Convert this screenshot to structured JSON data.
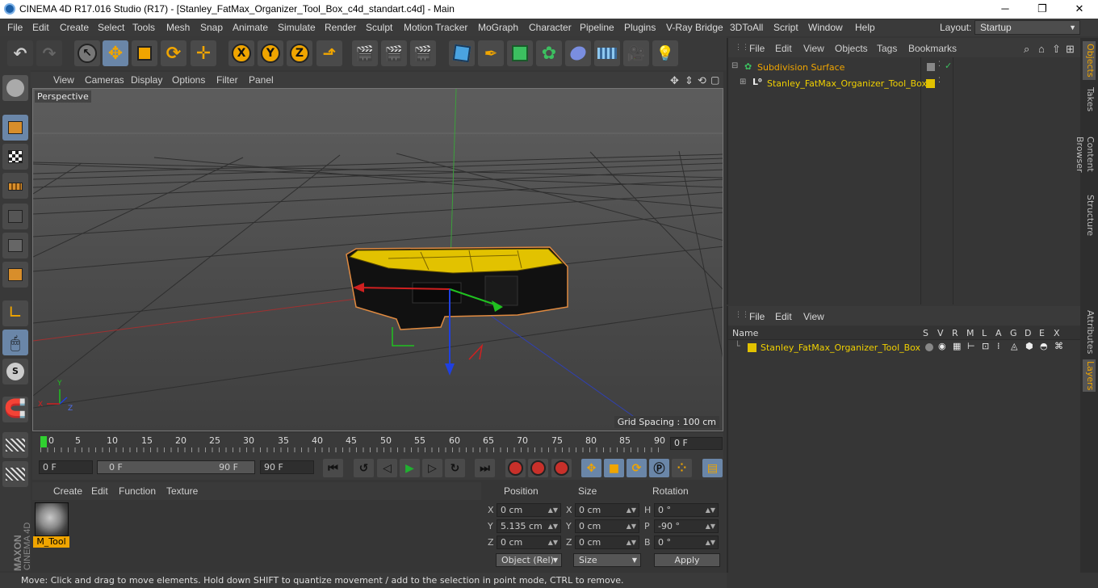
{
  "window": {
    "title": "CINEMA 4D R17.016 Studio (R17) - [Stanley_FatMax_Organizer_Tool_Box_c4d_standart.c4d] - Main",
    "minimize": "─",
    "maximize": "❐",
    "close": "✕"
  },
  "menubar": {
    "items": [
      "File",
      "Edit",
      "Create",
      "Select",
      "Tools",
      "Mesh",
      "Snap",
      "Animate",
      "Simulate",
      "Render",
      "Sculpt",
      "Motion Tracker",
      "MoGraph",
      "Character",
      "Pipeline",
      "Plugins",
      "V-Ray Bridge",
      "3DToAll",
      "Script",
      "Window",
      "Help"
    ],
    "layout_label": "Layout:",
    "layout_value": "Startup"
  },
  "toolbar": {
    "axis_x": "X",
    "axis_y": "Y",
    "axis_z": "Z"
  },
  "viewport": {
    "menu": [
      "View",
      "Cameras",
      "Display",
      "Options",
      "Filter",
      "Panel"
    ],
    "camera_label": "Perspective",
    "grid_spacing": "Grid Spacing : 100 cm",
    "axis_y": "Y",
    "axis_x": "X",
    "axis_z": "Z"
  },
  "timeline": {
    "ticks": [
      "0",
      "5",
      "10",
      "15",
      "20",
      "25",
      "30",
      "35",
      "40",
      "45",
      "50",
      "55",
      "60",
      "65",
      "70",
      "75",
      "80",
      "85",
      "90"
    ],
    "current_frame": "0 F"
  },
  "transport": {
    "start_field": "0 F",
    "range_start": "0 F",
    "range_end": "90 F",
    "end_field": "90 F"
  },
  "material_manager": {
    "menu": [
      "Create",
      "Edit",
      "Function",
      "Texture"
    ],
    "material_name": "M_Tool"
  },
  "coordinates": {
    "headers": {
      "position": "Position",
      "size": "Size",
      "rotation": "Rotation"
    },
    "pos_labels": [
      "X",
      "Y",
      "Z"
    ],
    "size_labels": [
      "X",
      "Y",
      "Z"
    ],
    "rot_labels": [
      "H",
      "P",
      "B"
    ],
    "position": [
      "0 cm",
      "5.135 cm",
      "0 cm"
    ],
    "size": [
      "0 cm",
      "0 cm",
      "0 cm"
    ],
    "rotation": [
      "0 °",
      "-90 °",
      "0 °"
    ],
    "mode_dropdown": "Object (Rel)",
    "size_dropdown": "Size",
    "apply_button": "Apply"
  },
  "object_manager": {
    "menu": [
      "File",
      "Edit",
      "View",
      "Objects",
      "Tags",
      "Bookmarks"
    ],
    "objects": [
      {
        "name": "Subdivision Surface"
      },
      {
        "name": "Stanley_FatMax_Organizer_Tool_Box"
      }
    ]
  },
  "layer_manager": {
    "menu": [
      "File",
      "Edit",
      "View"
    ],
    "columns": [
      "Name",
      "S",
      "V",
      "R",
      "M",
      "L",
      "A",
      "G",
      "D",
      "E",
      "X"
    ],
    "layers": [
      {
        "name": "Stanley_FatMax_Organizer_Tool_Box"
      }
    ]
  },
  "right_tabs": [
    "Objects",
    "Takes",
    "Content Browser",
    "Structure",
    "Attributes",
    "Layers"
  ],
  "status": "Move: Click and drag to move elements. Hold down SHIFT to quantize movement / add to the selection in point mode, CTRL to remove.",
  "brand": {
    "line1": "MAXON",
    "line2": "CINEMA 4D"
  },
  "colors": {
    "accent": "#f0a500",
    "selected": "#6a86a8",
    "object_yellow": "#e2c200"
  }
}
